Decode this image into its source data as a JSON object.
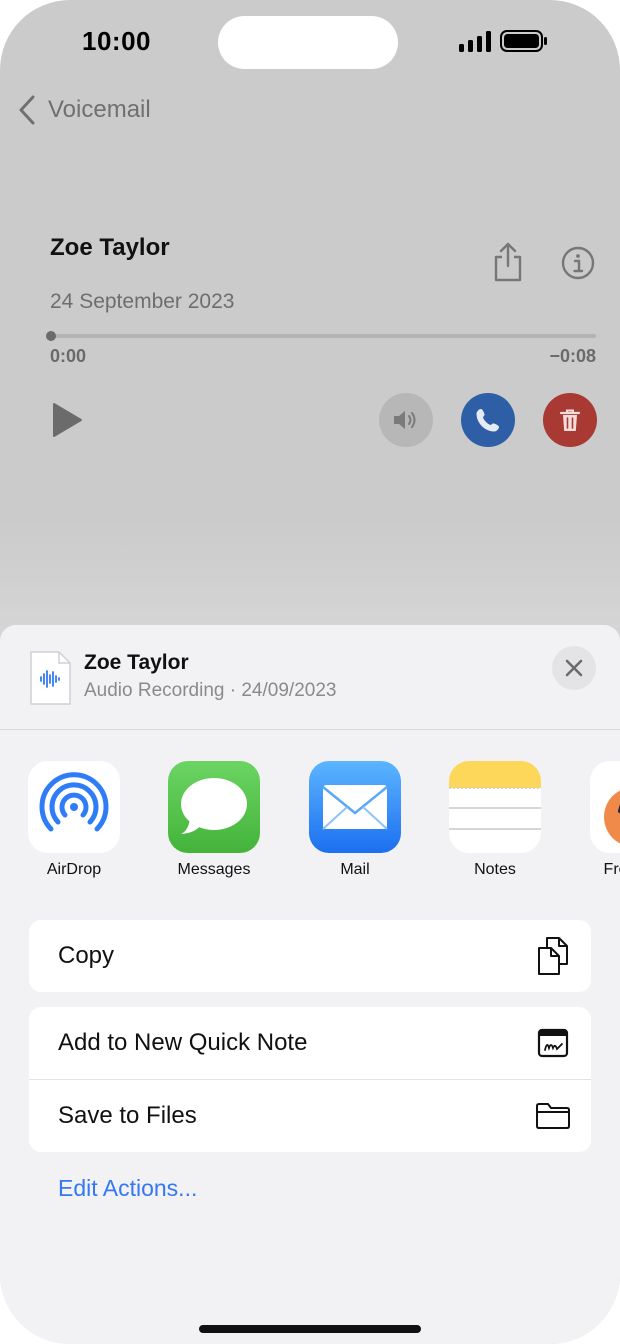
{
  "status_bar": {
    "time": "10:00"
  },
  "nav": {
    "back_label": "Voicemail",
    "back_icon": "chevron-left-icon"
  },
  "voicemail": {
    "name": "Zoe Taylor",
    "date": "24 September 2023",
    "elapsed": "0:00",
    "remaining": "−0:08",
    "progress": 0.0
  },
  "share_sheet": {
    "title": "Zoe Taylor",
    "subtitle": "Audio Recording · 24/09/2023",
    "apps": [
      {
        "label": "AirDrop",
        "icon": "airdrop-icon"
      },
      {
        "label": "Messages",
        "icon": "messages-icon"
      },
      {
        "label": "Mail",
        "icon": "mail-icon"
      },
      {
        "label": "Notes",
        "icon": "notes-icon"
      },
      {
        "label": "Freeform",
        "icon": "freeform-icon"
      }
    ],
    "actions": {
      "copy": "Copy",
      "quick_note": "Add to New Quick Note",
      "save_files": "Save to Files"
    },
    "edit_actions": "Edit Actions..."
  },
  "colors": {
    "call": "#2e5ea6",
    "delete": "#a83a33",
    "link": "#3478f6",
    "messages_green": "#5bc84f",
    "mail_blue": "#2f7df6",
    "notes_yellow": "#fdd75a"
  }
}
